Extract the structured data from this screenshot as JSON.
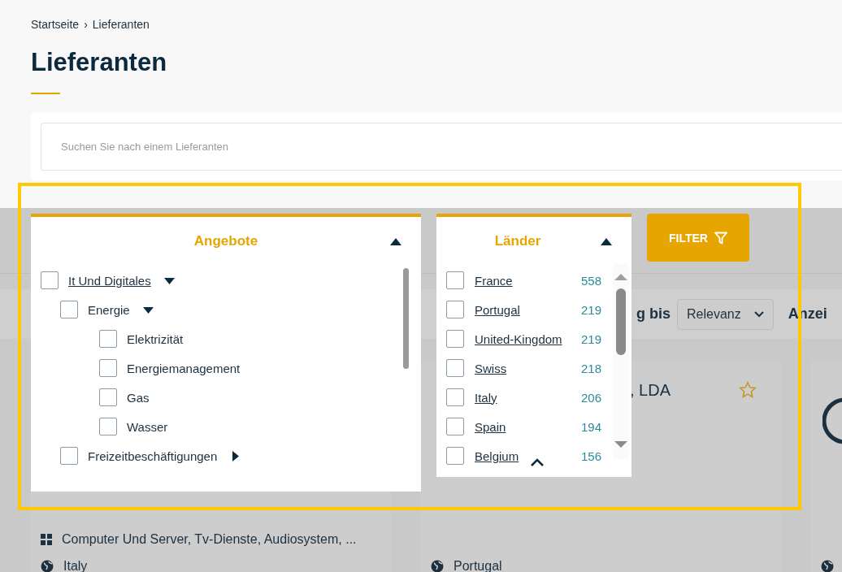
{
  "breadcrumb": [
    {
      "label": "Startseite",
      "separator": "›"
    },
    {
      "label": "Lieferanten"
    }
  ],
  "title": "Lieferanten",
  "search": {
    "placeholder": "Suchen Sie nach einem Lieferanten"
  },
  "toolbar": {
    "sort_label": "g bis",
    "sort_value": "Relevanz",
    "display_label": "Anzei"
  },
  "cards": [
    {
      "offers": "Computer Und Server, Tv-Dienste, Audiosystem, ...",
      "country": "Italy"
    },
    {
      "title": ", LDA",
      "country": "Portugal",
      "favorite": false
    },
    {
      "logo": true
    }
  ],
  "offers_panel": {
    "title": "Angebote",
    "expanded": true,
    "items": [
      {
        "label": "It Und Digitales",
        "kind": "link",
        "checked": false,
        "expanded": true,
        "children": [
          {
            "label": "Energie",
            "kind": "plain",
            "checked": false,
            "expanded": true,
            "children": [
              {
                "label": "Elektrizität",
                "kind": "plain",
                "checked": false
              },
              {
                "label": "Energiemanagement",
                "kind": "plain",
                "checked": false
              },
              {
                "label": "Gas",
                "kind": "plain",
                "checked": false
              },
              {
                "label": "Wasser",
                "kind": "plain",
                "checked": false
              }
            ]
          },
          {
            "label": "Freizeitbeschäftigungen",
            "kind": "plain",
            "checked": false,
            "expanded": false
          }
        ]
      }
    ]
  },
  "countries_panel": {
    "title": "Länder",
    "expanded": true,
    "items": [
      {
        "label": "France",
        "count": "558",
        "checked": false
      },
      {
        "label": "Portugal",
        "count": "219",
        "checked": false
      },
      {
        "label": "United-Kingdom",
        "count": "219",
        "checked": false
      },
      {
        "label": "Swiss",
        "count": "218",
        "checked": false
      },
      {
        "label": "Italy",
        "count": "206",
        "checked": false
      },
      {
        "label": "Spain",
        "count": "194",
        "checked": false
      },
      {
        "label": "Belgium",
        "count": "156",
        "checked": false
      }
    ]
  },
  "filter_button": "FILTER",
  "highlight": true
}
